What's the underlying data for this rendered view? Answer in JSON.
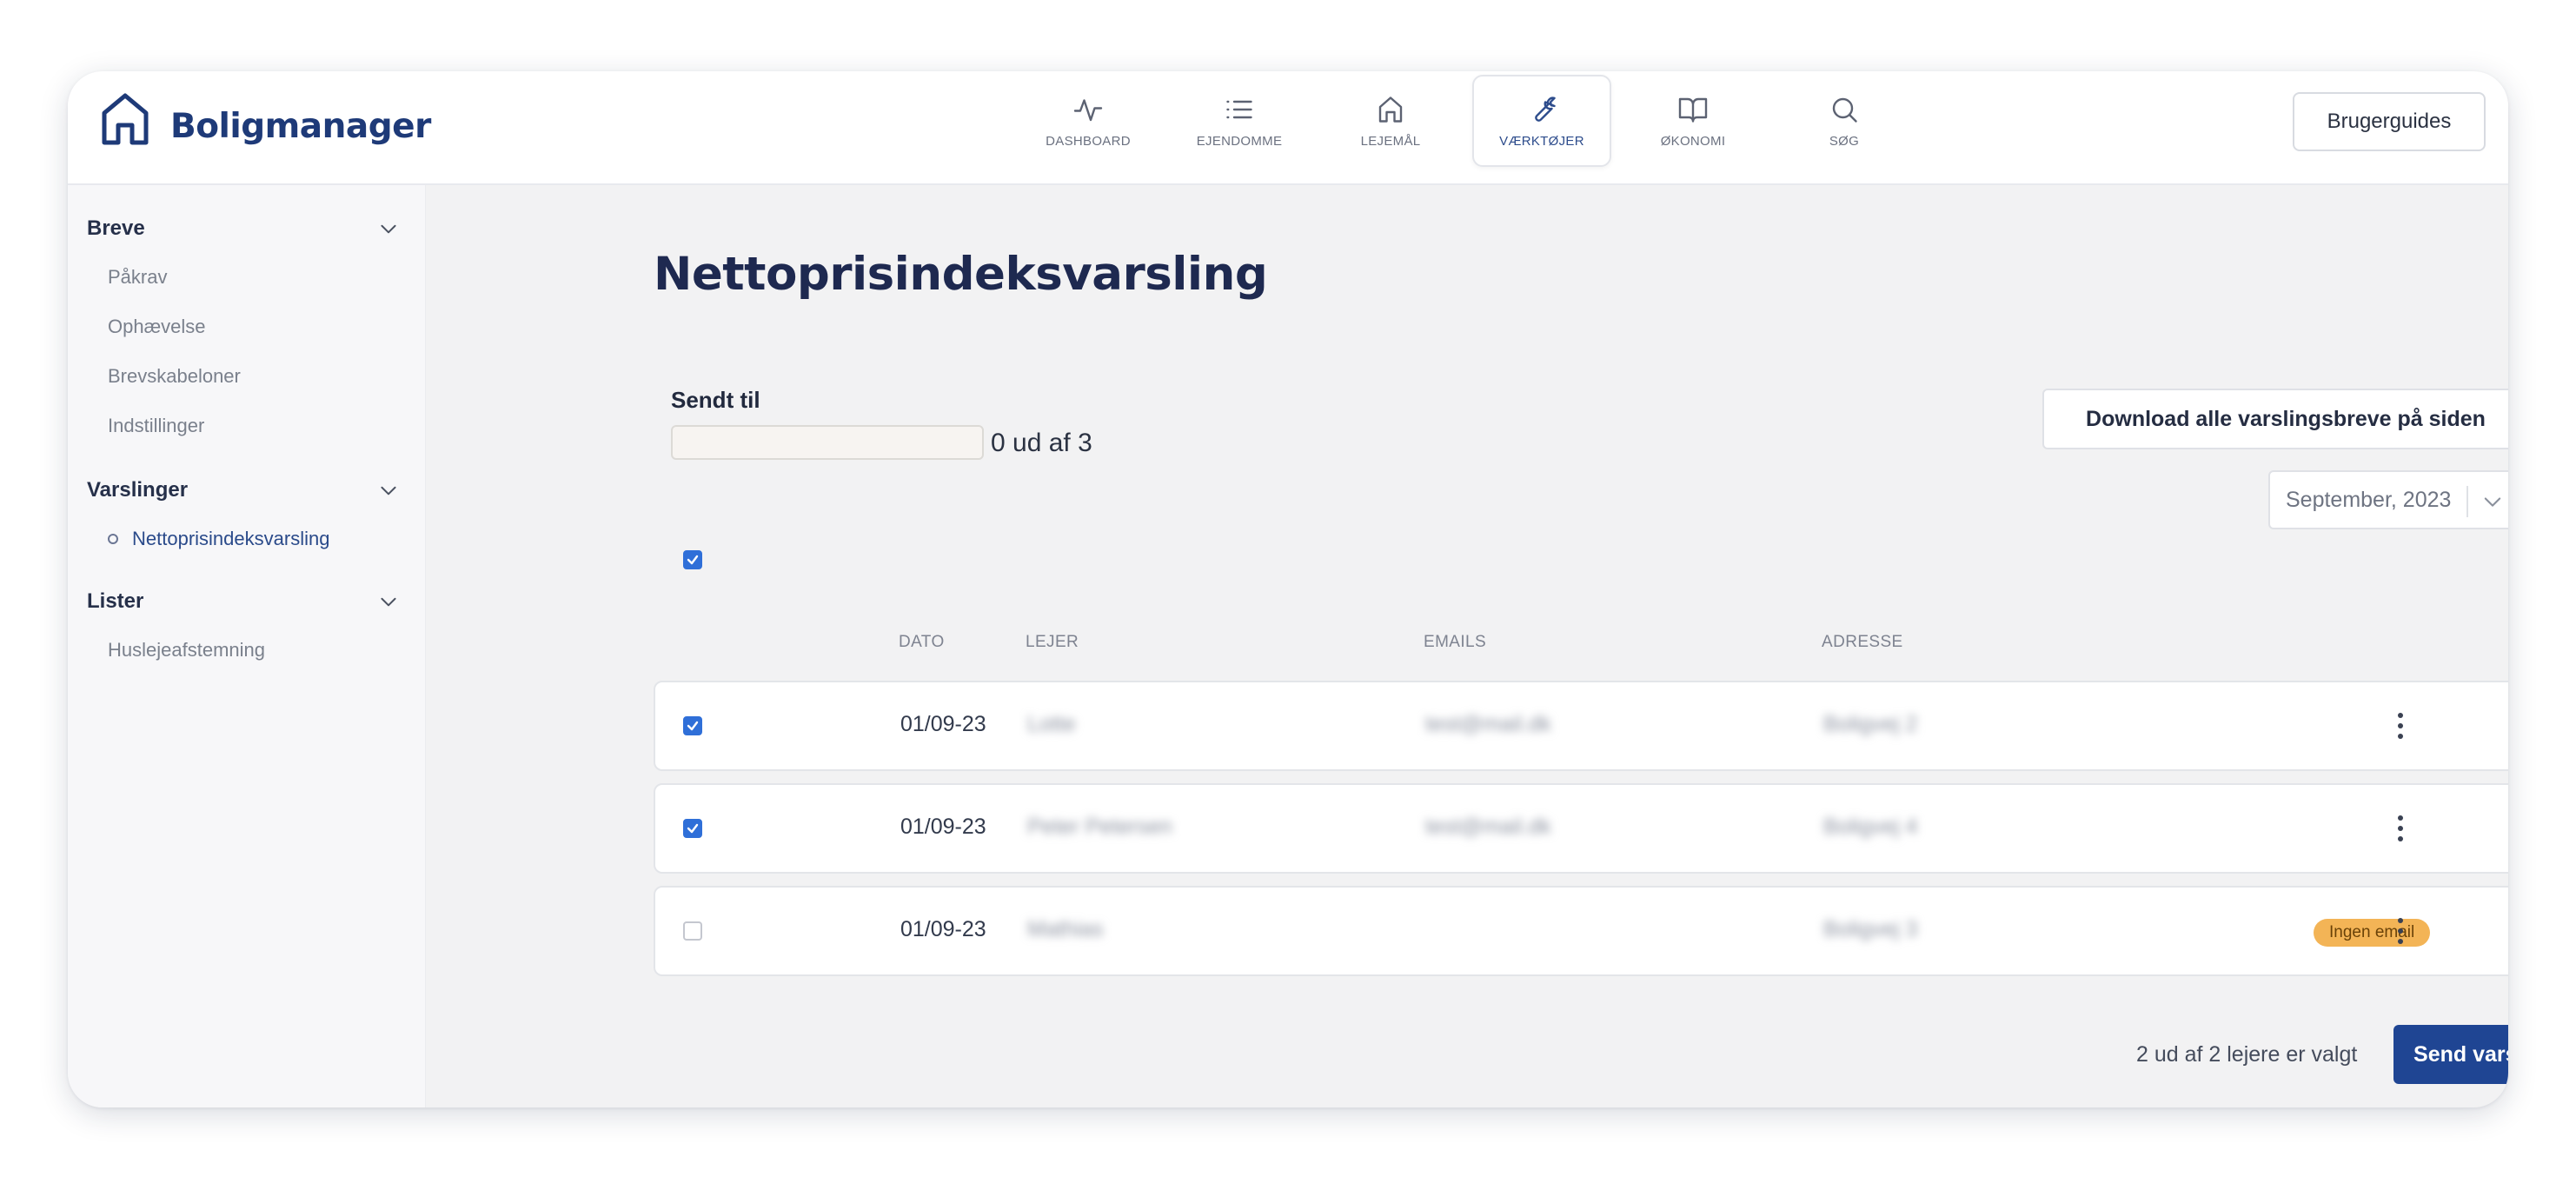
{
  "app": {
    "name": "Boligmanager"
  },
  "header": {
    "nav": [
      {
        "label": "DASHBOARD",
        "icon": "activity-icon"
      },
      {
        "label": "EJENDOMME",
        "icon": "list-icon"
      },
      {
        "label": "LEJEMÅL",
        "icon": "home-icon"
      },
      {
        "label": "VÆRKTØJER",
        "icon": "wrench-icon",
        "active": true
      },
      {
        "label": "ØKONOMI",
        "icon": "book-icon"
      },
      {
        "label": "SØG",
        "icon": "search-icon"
      }
    ],
    "guide_button": "Brugerguides"
  },
  "sidebar": {
    "sections": [
      {
        "title": "Breve",
        "items": [
          "Påkrav",
          "Ophævelse",
          "Brevskabeloner",
          "Indstillinger"
        ]
      },
      {
        "title": "Varslinger",
        "items": [
          "Nettoprisindeksvarsling"
        ],
        "active_item": "Nettoprisindeksvarsling"
      },
      {
        "title": "Lister",
        "items": [
          "Huslejeafstemning"
        ]
      }
    ]
  },
  "main": {
    "title": "Nettoprisindeksvarsling",
    "sendt_label": "Sendt til",
    "sendt_count": "0 ud af 3",
    "download_button": "Download alle varslingsbreve på siden",
    "month": "September, 2023",
    "columns": {
      "dato": "DATO",
      "lejer": "LEJER",
      "emails": "EMAILS",
      "adresse": "ADRESSE"
    },
    "header_checked": true,
    "rows": [
      {
        "checked": true,
        "dato": "01/09-23",
        "lejer": "Lotte",
        "email": "test@mail.dk",
        "adresse": "Boligvej 2",
        "badge": ""
      },
      {
        "checked": true,
        "dato": "01/09-23",
        "lejer": "Peter Petersen",
        "email": "test@mail.dk",
        "adresse": "Boligvej 4",
        "badge": ""
      },
      {
        "checked": false,
        "dato": "01/09-23",
        "lejer": "Mathias",
        "email": "",
        "adresse": "Boligvej 3",
        "badge": "Ingen email"
      }
    ],
    "selected_info": "2 ud af 2 lejere er valgt",
    "send_button": "Send varsling"
  },
  "colors": {
    "brand": "#1e3a78",
    "primary_button": "#1f4593",
    "checkbox": "#2f6fd8",
    "badge": "#f3b456"
  }
}
